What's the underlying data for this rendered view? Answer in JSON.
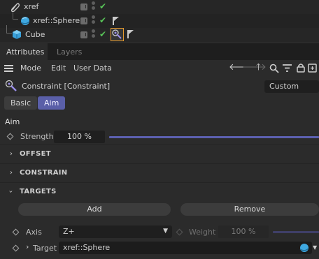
{
  "objects": [
    {
      "name": "xref",
      "icon": "xref-icon"
    },
    {
      "name": "xref::Sphere",
      "icon": "sphere-icon"
    },
    {
      "name": "Cube",
      "icon": "cube-icon"
    }
  ],
  "tabs": {
    "attributes": "Attributes",
    "layers": "Layers"
  },
  "menu": {
    "mode": "Mode",
    "edit": "Edit",
    "user_data": "User Data"
  },
  "object": {
    "title": "Constraint [Constraint]",
    "preset": "Custom"
  },
  "pills": {
    "basic": "Basic",
    "aim": "Aim"
  },
  "section": {
    "aim": "Aim"
  },
  "strength": {
    "label": "Strength",
    "value": "100 %",
    "fraction": 1.0
  },
  "groups": {
    "offset": "OFFSET",
    "constrain": "CONSTRAIN",
    "targets": "TARGETS"
  },
  "buttons": {
    "add": "Add",
    "remove": "Remove"
  },
  "axis": {
    "label": "Axis",
    "value": "Z+"
  },
  "weight": {
    "label": "Weight",
    "value": "100 %"
  },
  "target": {
    "label": "Target",
    "value": "xref::Sphere"
  },
  "colors": {
    "accent": "#5a5fa8",
    "check": "#58c458",
    "highlight": "#e59a2e"
  }
}
